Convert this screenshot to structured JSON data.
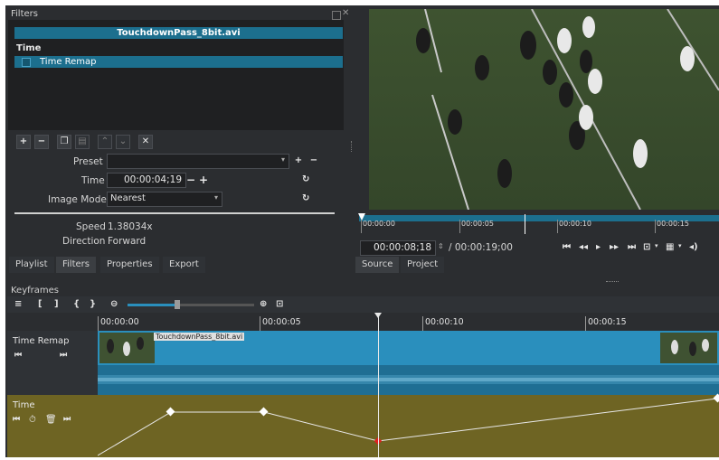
{
  "filters": {
    "panel_title": "Filters",
    "clip_name": "TouchdownPass_8bit.avi",
    "section_header": "Time",
    "selected_filter": "Time Remap",
    "toolbar_icons": [
      "plus-icon",
      "minus-icon",
      "copy-icon",
      "paste-icon",
      "up-icon",
      "down-icon",
      "close-icon"
    ],
    "preset_label": "Preset",
    "preset_value": "",
    "time_label": "Time",
    "time_value": "00:00:04;19",
    "image_mode_label": "Image Mode",
    "image_mode_value": "Nearest",
    "speed_label": "Speed",
    "speed_value": "1.38034x",
    "direction_label": "Direction",
    "direction_value": "Forward"
  },
  "tabs": [
    "Playlist",
    "Filters",
    "Properties",
    "Export"
  ],
  "active_tab": "Filters",
  "player": {
    "ruler_ticks": [
      "00:00:00",
      "00:00:05",
      "00:00:10",
      "00:00:15"
    ],
    "position": "00:00:08;18",
    "duration": "/ 00:00:19;00",
    "tabs": [
      "Source",
      "Project"
    ],
    "active_tab": "Source",
    "playhead_fraction": 0.46
  },
  "keyframes": {
    "panel_title": "Keyframes",
    "ruler_ticks": [
      "00:00:00",
      "00:00:05",
      "00:00:10",
      "00:00:15"
    ],
    "clip_label": "TouchdownPass_8bit.avi",
    "track_timeremap": "Time Remap",
    "track_time": "Time",
    "colors": {
      "clip": "#2a8fbd",
      "param_track": "#6e6423",
      "keyframe_line": "#e8e8e8",
      "playhead_keyframe": "#e02020"
    }
  }
}
